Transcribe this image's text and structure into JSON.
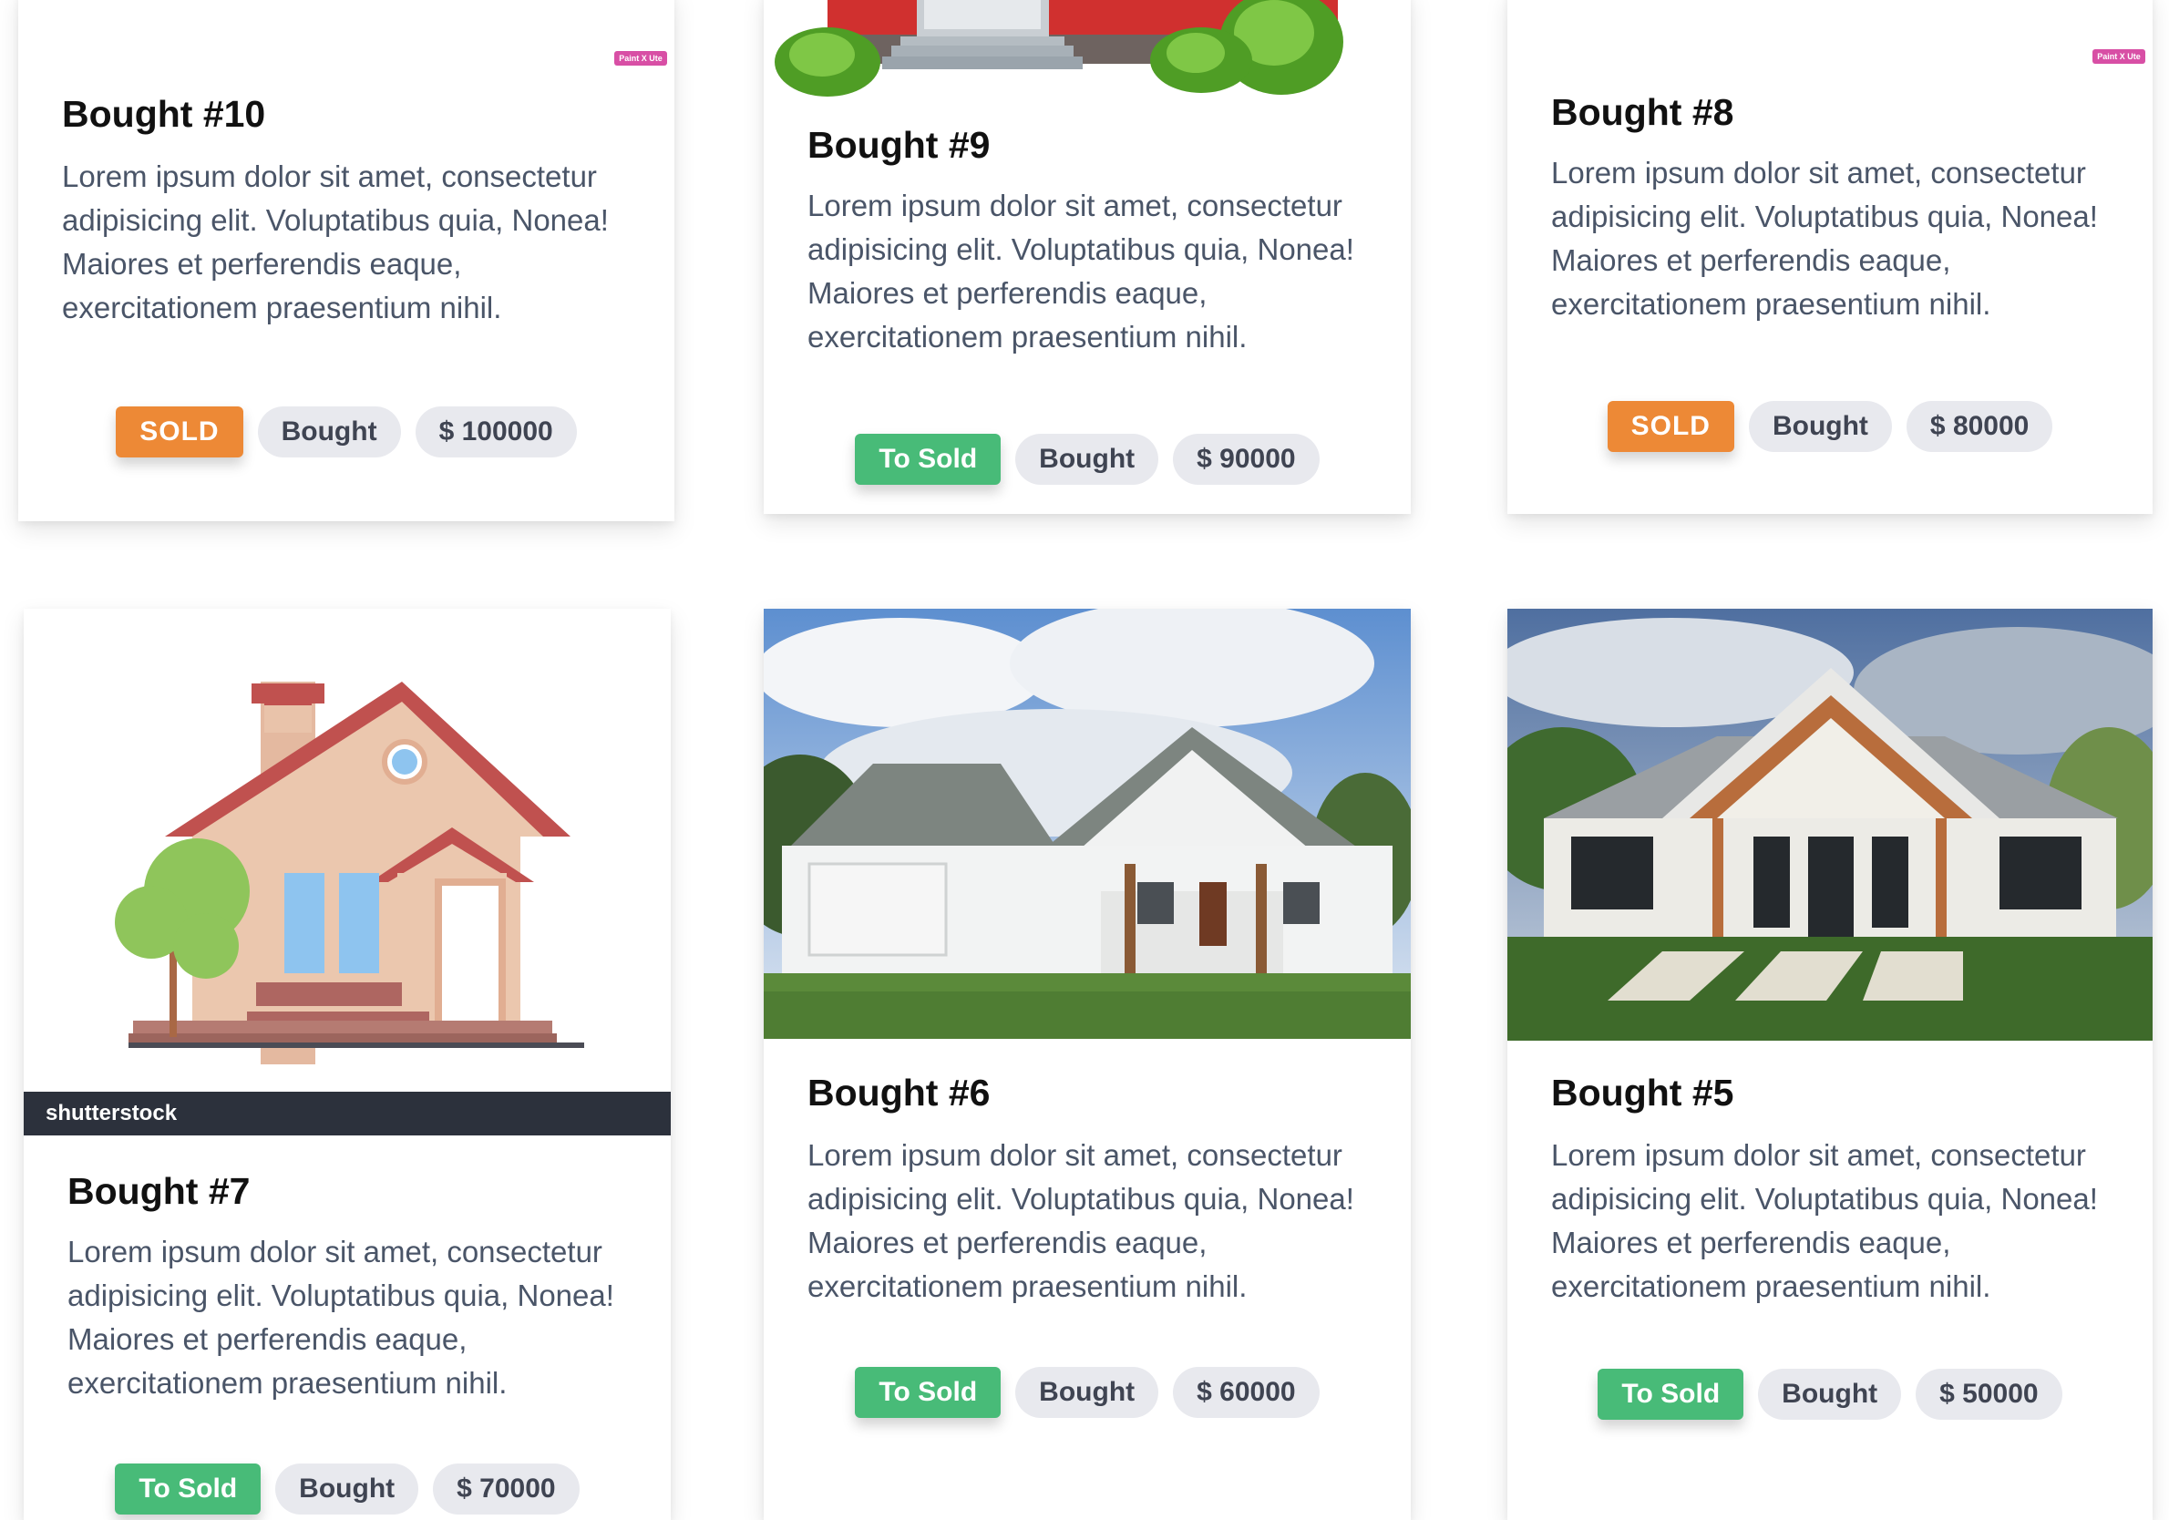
{
  "cards": [
    {
      "title": "Bought #10",
      "text": "Lorem ipsum dolor sit amet, consectetur adipisicing elit. Voluptatibus quia, Nonea! Maiores et perferendis eaque, exercitationem praesentium nihil.",
      "status": "SOLD",
      "type": "Bought",
      "price": "$ 100000",
      "tag": "Paint X Ute"
    },
    {
      "title": "Bought #9",
      "text": "Lorem ipsum dolor sit amet, consectetur adipisicing elit. Voluptatibus quia, Nonea! Maiores et perferendis eaque, exercitationem praesentium nihil.",
      "status": "To Sold",
      "type": "Bought",
      "price": "$ 90000"
    },
    {
      "title": "Bought #8",
      "text": "Lorem ipsum dolor sit amet, consectetur adipisicing elit. Voluptatibus quia, Nonea! Maiores et perferendis eaque, exercitationem praesentium nihil.",
      "status": "SOLD",
      "type": "Bought",
      "price": "$ 80000",
      "tag": "Paint X Ute"
    },
    {
      "title": "Bought #7",
      "text": "Lorem ipsum dolor sit amet, consectetur adipisicing elit. Voluptatibus quia, Nonea! Maiores et perferendis eaque, exercitationem praesentium nihil.",
      "status": "To Sold",
      "type": "Bought",
      "price": "$ 70000",
      "watermark": "shutterstock"
    },
    {
      "title": "Bought #6",
      "text": "Lorem ipsum dolor sit amet, consectetur adipisicing elit. Voluptatibus quia, Nonea! Maiores et perferendis eaque, exercitationem praesentium nihil.",
      "status": "To Sold",
      "type": "Bought",
      "price": "$ 60000"
    },
    {
      "title": "Bought #5",
      "text": "Lorem ipsum dolor sit amet, consectetur adipisicing elit. Voluptatibus quia, Nonea! Maiores et perferendis eaque, exercitationem praesentium nihil.",
      "status": "To Sold",
      "type": "Bought",
      "price": "$ 50000"
    }
  ],
  "colors": {
    "sold": "#ed8936",
    "to_sold": "#48bb78",
    "pill": "#e8e9ee",
    "text": "#4a5568"
  }
}
